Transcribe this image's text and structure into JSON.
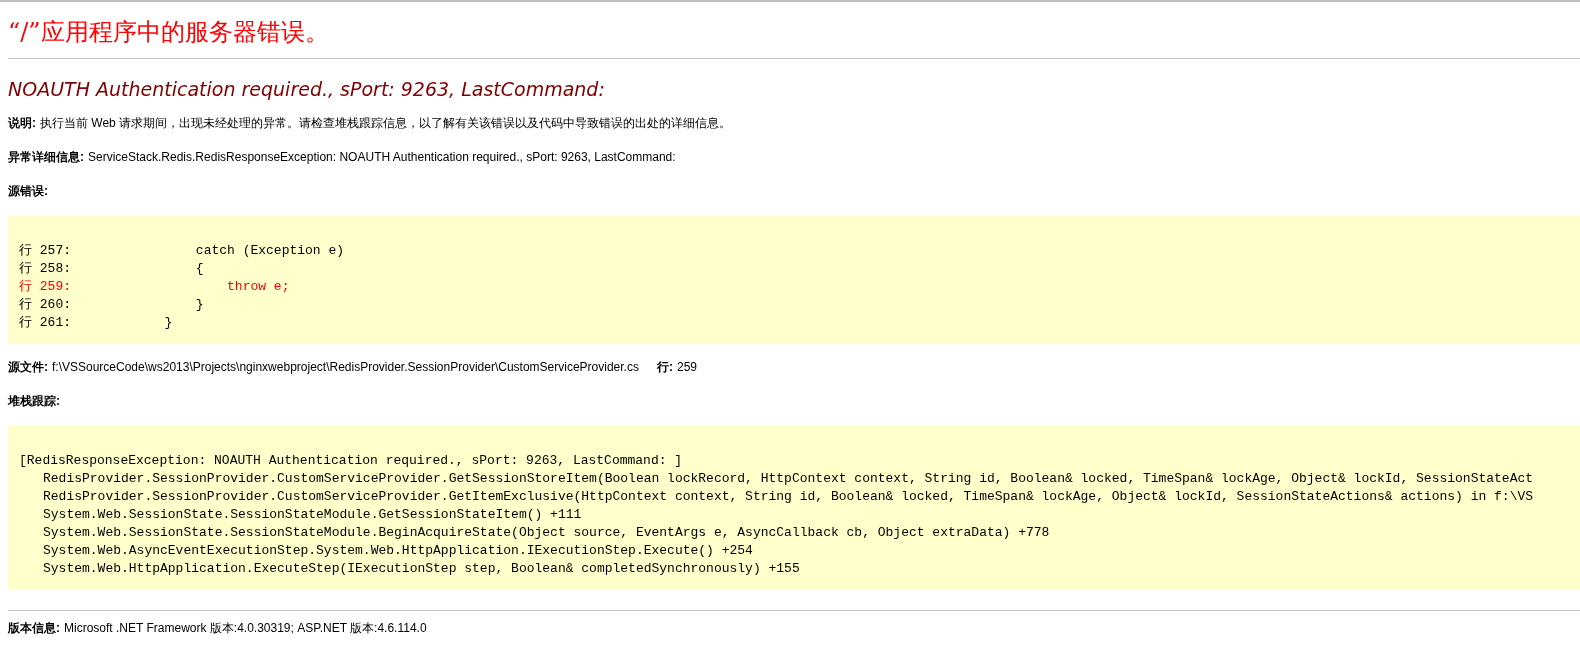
{
  "title": "“/”应用程序中的服务器错误。",
  "error_heading": "NOAUTH Authentication required., sPort: 9263, LastCommand:",
  "description": {
    "label": "说明:",
    "text": "执行当前 Web 请求期间，出现未经处理的异常。请检查堆栈跟踪信息，以了解有关该错误以及代码中导致错误的出处的详细信息。"
  },
  "exception_details": {
    "label": "异常详细信息:",
    "text": "ServiceStack.Redis.RedisResponseException: NOAUTH Authentication required., sPort: 9263, LastCommand:"
  },
  "source_error": {
    "label": "源错误:",
    "lines": [
      {
        "text": "行 257:                catch (Exception e)",
        "highlighted": false
      },
      {
        "text": "行 258:                {",
        "highlighted": false
      },
      {
        "text": "行 259:                    throw e;",
        "highlighted": true
      },
      {
        "text": "行 260:                }",
        "highlighted": false
      },
      {
        "text": "行 261:            }",
        "highlighted": false
      }
    ]
  },
  "source_file": {
    "label": "源文件:",
    "path": "f:\\VSSourceCode\\ws2013\\Projects\\nginxwebproject\\RedisProvider.SessionProvider\\CustomServiceProvider.cs",
    "line_label": "行:",
    "line": "259"
  },
  "stack_trace": {
    "label": "堆栈跟踪:",
    "header": "[RedisResponseException: NOAUTH Authentication required., sPort: 9263, LastCommand: ]",
    "frames": [
      "RedisProvider.SessionProvider.CustomServiceProvider.GetSessionStoreItem(Boolean lockRecord, HttpContext context, String id, Boolean& locked, TimeSpan& lockAge, Object& lockId, SessionStateAct",
      "RedisProvider.SessionProvider.CustomServiceProvider.GetItemExclusive(HttpContext context, String id, Boolean& locked, TimeSpan& lockAge, Object& lockId, SessionStateActions& actions) in f:\\VS",
      "System.Web.SessionState.SessionStateModule.GetSessionStateItem() +111",
      "System.Web.SessionState.SessionStateModule.BeginAcquireState(Object source, EventArgs e, AsyncCallback cb, Object extraData) +778",
      "System.Web.AsyncEventExecutionStep.System.Web.HttpApplication.IExecutionStep.Execute() +254",
      "System.Web.HttpApplication.ExecuteStep(IExecutionStep step, Boolean& completedSynchronously) +155"
    ]
  },
  "version_info": {
    "label": "版本信息:",
    "text": "Microsoft .NET Framework 版本:4.0.30319; ASP.NET 版本:4.6.114.0"
  }
}
